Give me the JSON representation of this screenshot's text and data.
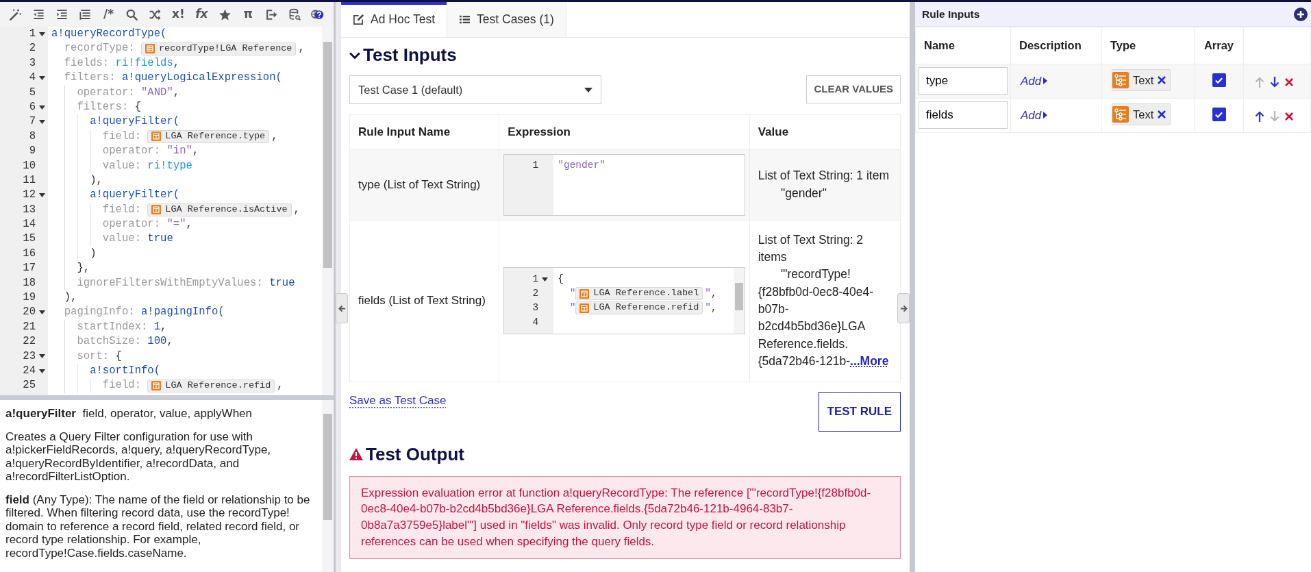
{
  "toolbar": [
    {
      "kind": "wand"
    },
    {
      "kind": "outdent"
    },
    {
      "kind": "indent"
    },
    {
      "kind": "format"
    },
    {
      "kind": "text",
      "text": "/*"
    },
    {
      "kind": "search"
    },
    {
      "kind": "shuffle"
    },
    {
      "kind": "text",
      "text": "x!"
    },
    {
      "kind": "text",
      "text": "fx"
    },
    {
      "kind": "star"
    },
    {
      "kind": "text",
      "text": "π"
    },
    {
      "kind": "export"
    },
    {
      "kind": "database"
    },
    {
      "kind": "help"
    }
  ],
  "code_editor": {
    "lines": [
      {
        "number": "1",
        "foldable": true,
        "tokens": [
          {
            "kind": "fn",
            "text": "a!queryRecordType("
          }
        ]
      },
      {
        "number": "2",
        "foldable": false,
        "tokens": [
          {
            "kind": "key",
            "text": "  recordType: "
          },
          {
            "kind": "record-chip",
            "text": "recordType!LGA Reference"
          },
          {
            "kind": "punct",
            "text": ","
          }
        ]
      },
      {
        "number": "3",
        "foldable": false,
        "tokens": [
          {
            "kind": "key",
            "text": "  fields: "
          },
          {
            "kind": "ri",
            "text": "ri!fields"
          },
          {
            "kind": "punct",
            "text": ","
          }
        ]
      },
      {
        "number": "4",
        "foldable": true,
        "tokens": [
          {
            "kind": "key",
            "text": "  filters: "
          },
          {
            "kind": "fn",
            "text": "a!queryLogicalExpression("
          }
        ]
      },
      {
        "number": "5",
        "foldable": false,
        "tokens": [
          {
            "kind": "key",
            "text": "    operator: "
          },
          {
            "kind": "str",
            "text": "\"AND\""
          },
          {
            "kind": "punct",
            "text": ","
          }
        ]
      },
      {
        "number": "6",
        "foldable": true,
        "tokens": [
          {
            "kind": "key",
            "text": "    filters: "
          },
          {
            "kind": "punct",
            "text": "{"
          }
        ]
      },
      {
        "number": "7",
        "foldable": true,
        "tokens": [
          {
            "kind": "fn",
            "text": "      a!queryFilter("
          }
        ]
      },
      {
        "number": "8",
        "foldable": false,
        "tokens": [
          {
            "kind": "key",
            "text": "        field: "
          },
          {
            "kind": "field-chip",
            "text": "LGA Reference.type"
          },
          {
            "kind": "punct",
            "text": ","
          }
        ]
      },
      {
        "number": "9",
        "foldable": false,
        "tokens": [
          {
            "kind": "key",
            "text": "        operator: "
          },
          {
            "kind": "str",
            "text": "\"in\""
          },
          {
            "kind": "punct",
            "text": ","
          }
        ]
      },
      {
        "number": "10",
        "foldable": false,
        "tokens": [
          {
            "kind": "key",
            "text": "        value: "
          },
          {
            "kind": "ri",
            "text": "ri!type"
          }
        ]
      },
      {
        "number": "11",
        "foldable": false,
        "tokens": [
          {
            "kind": "punct",
            "text": "      ),"
          }
        ]
      },
      {
        "number": "12",
        "foldable": true,
        "tokens": [
          {
            "kind": "fn",
            "text": "      a!queryFilter("
          }
        ]
      },
      {
        "number": "13",
        "foldable": false,
        "tokens": [
          {
            "kind": "key",
            "text": "        field: "
          },
          {
            "kind": "field-chip",
            "text": "LGA Reference.isActive"
          },
          {
            "kind": "punct",
            "text": ","
          }
        ]
      },
      {
        "number": "14",
        "foldable": false,
        "tokens": [
          {
            "kind": "key",
            "text": "        operator: "
          },
          {
            "kind": "str",
            "text": "\"=\""
          },
          {
            "kind": "punct",
            "text": ","
          }
        ]
      },
      {
        "number": "15",
        "foldable": false,
        "tokens": [
          {
            "kind": "key",
            "text": "        value: "
          },
          {
            "kind": "kw",
            "text": "true"
          }
        ]
      },
      {
        "number": "16",
        "foldable": false,
        "tokens": [
          {
            "kind": "punct",
            "text": "      )"
          }
        ]
      },
      {
        "number": "17",
        "foldable": false,
        "tokens": [
          {
            "kind": "punct",
            "text": "    },"
          }
        ]
      },
      {
        "number": "18",
        "foldable": false,
        "tokens": [
          {
            "kind": "key",
            "text": "    ignoreFiltersWithEmptyValues: "
          },
          {
            "kind": "kw",
            "text": "true"
          }
        ]
      },
      {
        "number": "19",
        "foldable": false,
        "tokens": [
          {
            "kind": "punct",
            "text": "  ),"
          }
        ]
      },
      {
        "number": "20",
        "foldable": true,
        "tokens": [
          {
            "kind": "key",
            "text": "  pagingInfo: "
          },
          {
            "kind": "fn",
            "text": "a!pagingInfo("
          }
        ]
      },
      {
        "number": "21",
        "foldable": false,
        "tokens": [
          {
            "kind": "key",
            "text": "    startIndex: "
          },
          {
            "kind": "num",
            "text": "1"
          },
          {
            "kind": "punct",
            "text": ","
          }
        ]
      },
      {
        "number": "22",
        "foldable": false,
        "tokens": [
          {
            "kind": "key",
            "text": "    batchSize: "
          },
          {
            "kind": "num",
            "text": "100"
          },
          {
            "kind": "punct",
            "text": ","
          }
        ]
      },
      {
        "number": "23",
        "foldable": true,
        "tokens": [
          {
            "kind": "key",
            "text": "    sort: "
          },
          {
            "kind": "punct",
            "text": "{"
          }
        ]
      },
      {
        "number": "24",
        "foldable": true,
        "tokens": [
          {
            "kind": "fn",
            "text": "      a!sortInfo("
          }
        ]
      },
      {
        "number": "25",
        "foldable": false,
        "tokens": [
          {
            "kind": "key",
            "text": "        field: "
          },
          {
            "kind": "field-chip",
            "text": "LGA Reference.refid"
          },
          {
            "kind": "punct",
            "text": ","
          }
        ]
      }
    ]
  },
  "help": {
    "function_name": "a!queryFilter",
    "parameters": "field, operator, value, applyWhen",
    "paragraphs": [
      "Creates a Query Filter configuration for use with a!pickerFieldRecords, a!query, a!queryRecordType, a!queryRecordByIdentifier, a!recordData, and a!recordFilterListOption.",
      "**field** (Any Type): The name of the field or relationship to be filtered. When filtering record data, use the recordType! domain to reference a record field, related record field, or record type relationship. For example, recordType!Case.fields.caseName."
    ]
  },
  "tabs": [
    {
      "kind": "edit",
      "label": "Ad Hoc Test",
      "selected": true
    },
    {
      "kind": "list",
      "label": "Test Cases (1)",
      "selected": false
    }
  ],
  "test_inputs": {
    "title": "Test Inputs",
    "expanded": true,
    "test_case_select": {
      "value": "Test Case 1 (default)"
    },
    "clear_button": "CLEAR VALUES",
    "columns": [
      "Rule Input Name",
      "Expression",
      "Value"
    ],
    "rows": [
      {
        "name": "type (List of Text String)",
        "expression": [
          {
            "number": "1",
            "foldable": false,
            "tokens": [
              {
                "kind": "str",
                "text": "\"gender\""
              }
            ]
          }
        ],
        "value": {
          "summary": "List of Text String: 1 item",
          "item": "\"gender\""
        }
      },
      {
        "name": "fields (List of Text String)",
        "expression": [
          {
            "number": "1",
            "foldable": true,
            "tokens": [
              {
                "kind": "punct",
                "text": "{"
              }
            ]
          },
          {
            "number": "2",
            "foldable": false,
            "tokens": [
              {
                "kind": "str",
                "text": "  \""
              },
              {
                "kind": "field-chip",
                "text": "LGA Reference.label"
              },
              {
                "kind": "str",
                "text": "\""
              },
              {
                "kind": "punct",
                "text": ","
              }
            ]
          },
          {
            "number": "3",
            "foldable": false,
            "tokens": [
              {
                "kind": "str",
                "text": "  \""
              },
              {
                "kind": "field-chip",
                "text": "LGA Reference.refid"
              },
              {
                "kind": "str",
                "text": "\""
              },
              {
                "kind": "punct",
                "text": ","
              }
            ]
          },
          {
            "number": "4",
            "foldable": false
          }
        ],
        "value": {
          "summary": "List of Text String: 2 items",
          "item": "\"'recordType!{f28bfb0d-0ec8-40e4-b07b-b2cd4b5bd36e}LGA Reference.fields.{5da72b46-121b-",
          "more": "...More"
        }
      }
    ],
    "save_link": "Save as Test Case",
    "test_button": "TEST RULE"
  },
  "test_output": {
    "title": "Test Output",
    "message": "Expression evaluation error at function a!queryRecordType: The reference [\"'recordType!{f28bfb0d-0ec8-40e4-b07b-b2cd4b5bd36e}LGA Reference.fields.{5da72b46-121b-4964-83b7-0b8a7a3759e5}label'\"] used in \"fields\" was invalid. Only record type field or record relationship references can be used when specifying the query fields."
  },
  "rule_inputs": {
    "title": "Rule Inputs",
    "columns": [
      "Name",
      "Description",
      "Type",
      "Array"
    ],
    "rows": [
      {
        "name": "type",
        "description_link": "Add",
        "type": "Text",
        "array": true,
        "can_move_up": false,
        "can_move_down": true
      },
      {
        "name": "fields",
        "description_link": "Add",
        "type": "Text",
        "array": true,
        "can_move_up": true,
        "can_move_down": false
      }
    ]
  }
}
